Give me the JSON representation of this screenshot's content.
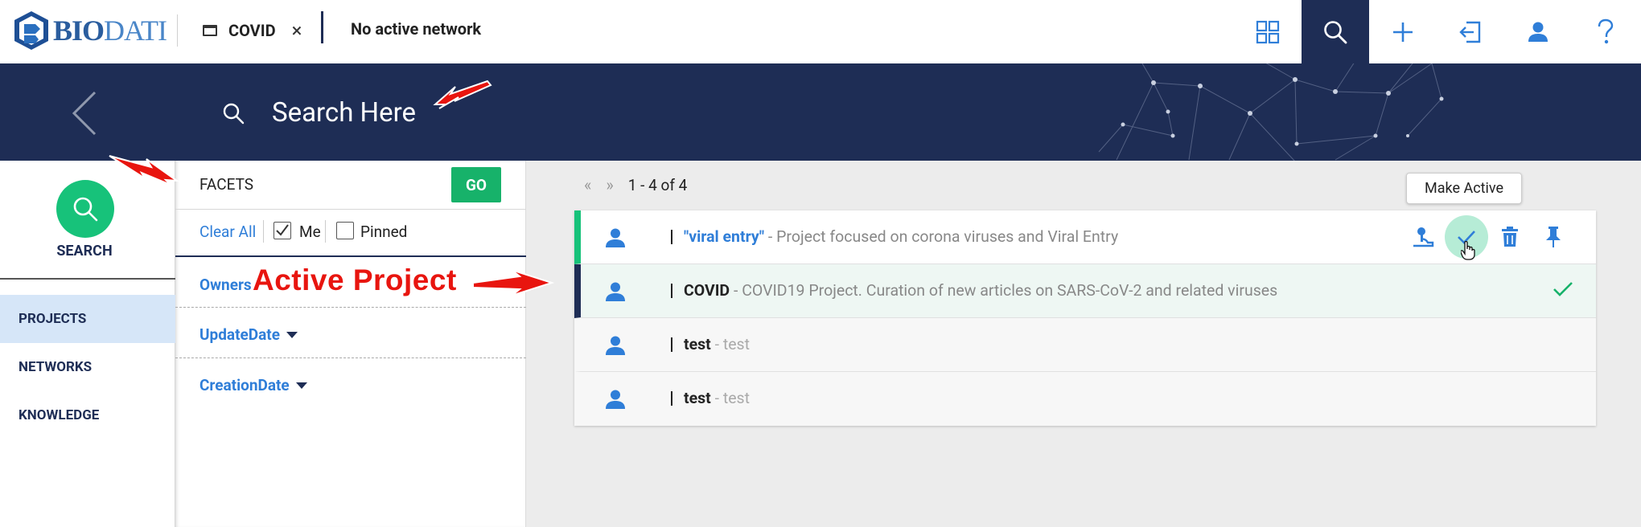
{
  "header": {
    "logo_text_bio": "BIO",
    "logo_text_dati": "DATI",
    "tab_label": "COVID",
    "tab_close": "×",
    "network_status": "No active network",
    "icons": [
      "grid-icon",
      "search-icon",
      "plus-icon",
      "exit-icon",
      "user-icon",
      "help-icon"
    ]
  },
  "banner": {
    "search_placeholder": "Search Here"
  },
  "nav": {
    "search_label": "SEARCH",
    "items": [
      {
        "label": "PROJECTS",
        "selected": true
      },
      {
        "label": "NETWORKS",
        "selected": false
      },
      {
        "label": "KNOWLEDGE",
        "selected": false
      }
    ]
  },
  "facets": {
    "title": "FACETS",
    "go_label": "GO",
    "clear_all": "Clear All",
    "me_label": "Me",
    "me_checked": true,
    "pinned_label": "Pinned",
    "pinned_checked": false,
    "groups": [
      "Owners",
      "UpdateDate",
      "CreationDate"
    ]
  },
  "results": {
    "pager_prev": "«",
    "pager_next": "»",
    "range": "1 - 4 of 4",
    "tooltip": "Make Active",
    "rows": [
      {
        "name": "\"viral entry\"",
        "desc": " - Project focused on corona viruses and Viral Entry",
        "state": "hover"
      },
      {
        "name": "COVID",
        "desc": " - COVID19 Project. Curation of new articles on SARS-CoV-2 and related viruses",
        "state": "active"
      },
      {
        "name": "test",
        "desc": " - test",
        "state": "plain"
      },
      {
        "name": "test",
        "desc": " - test",
        "state": "plain"
      }
    ]
  },
  "annotation": {
    "label": "Active Project",
    "color": "#e8150f"
  },
  "colors": {
    "navy": "#1e2d55",
    "accent_green": "#17c27a",
    "link_blue": "#2f7ed8"
  }
}
